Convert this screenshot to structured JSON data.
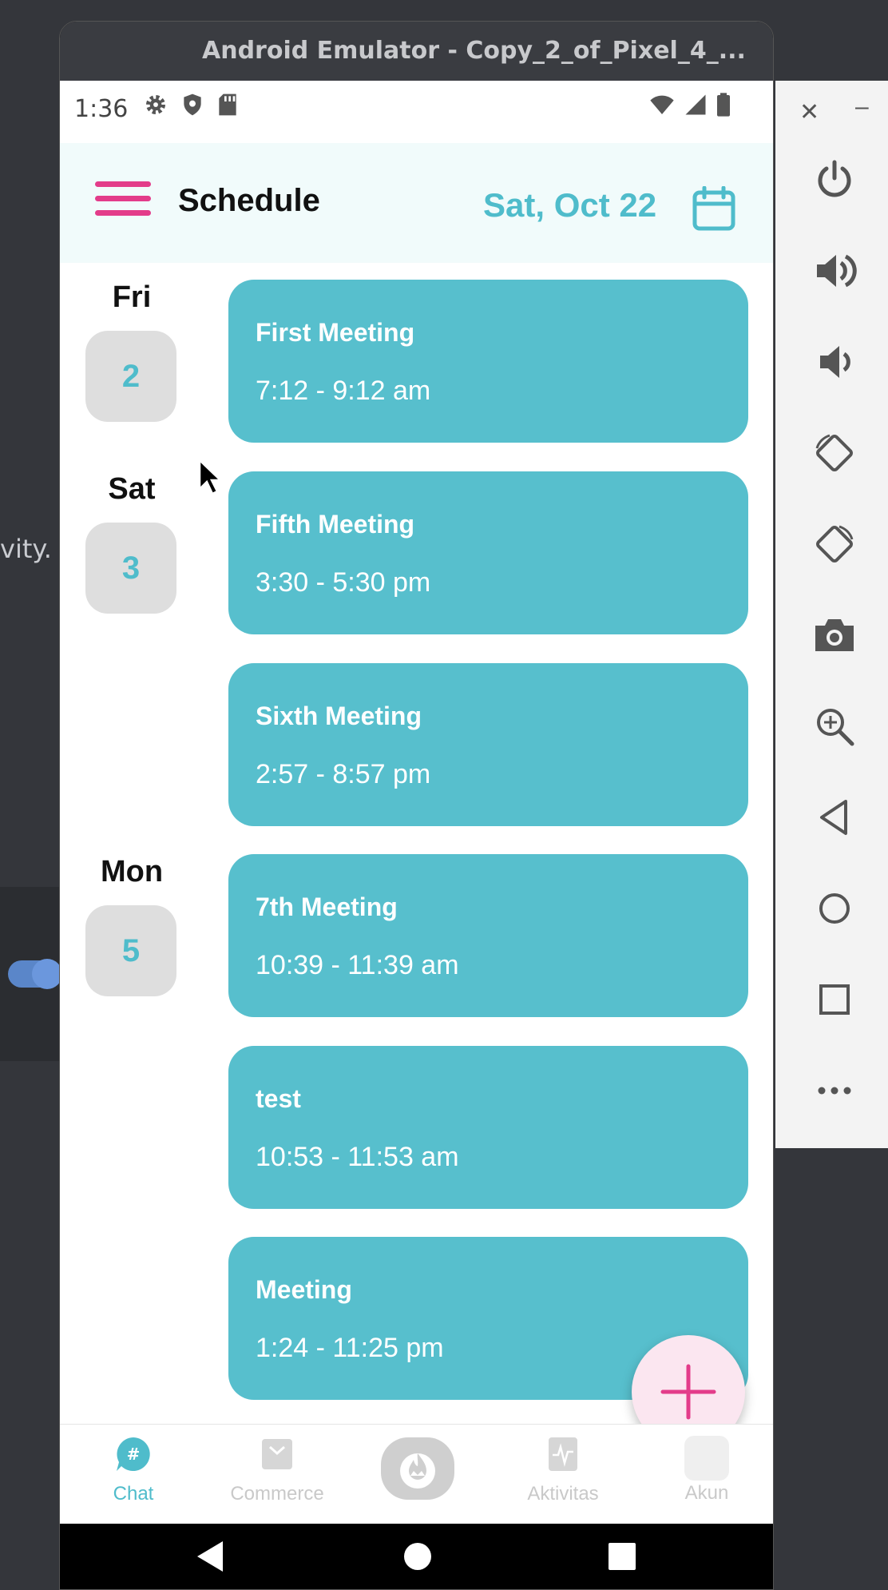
{
  "background": {
    "text": "vity."
  },
  "emulator": {
    "title": "Android Emulator - Copy_2_of_Pixel_4_..."
  },
  "statusbar": {
    "time": "1:36"
  },
  "appbar": {
    "title": "Schedule",
    "date": "Sat, Oct 22"
  },
  "days": [
    {
      "name": "Fri",
      "number": "2"
    },
    {
      "name": "Sat",
      "number": "3"
    },
    {
      "name": "Mon",
      "number": "5"
    }
  ],
  "events": [
    {
      "title": "First Meeting",
      "time": "7:12 - 9:12 am"
    },
    {
      "title": "Fifth Meeting",
      "time": "3:30 - 5:30 pm"
    },
    {
      "title": "Sixth Meeting",
      "time": "2:57 - 8:57 pm"
    },
    {
      "title": "7th Meeting",
      "time": "10:39 - 11:39 am"
    },
    {
      "title": "test",
      "time": "10:53 - 11:53 am"
    },
    {
      "title": "Meeting",
      "time": "1:24 - 11:25 pm"
    }
  ],
  "bottomnav": {
    "items": [
      {
        "label": "Chat",
        "icon": "chat-icon",
        "active": true
      },
      {
        "label": "Commerce",
        "icon": "commerce-icon",
        "active": false
      },
      {
        "label": "",
        "icon": "fire-icon",
        "active": false
      },
      {
        "label": "Aktivitas",
        "icon": "activity-icon",
        "active": false
      },
      {
        "label": "Akun",
        "icon": "account-icon",
        "active": false
      }
    ]
  },
  "colors": {
    "accent": "#4fbccb",
    "card": "#57bfcd",
    "pink": "#e33c8a",
    "appbar_bg": "#f1fbfb"
  },
  "toolbar": {
    "buttons": [
      "power-icon",
      "volume-up-icon",
      "volume-down-icon",
      "rotate-left-icon",
      "rotate-right-icon",
      "camera-icon",
      "zoom-icon",
      "back-icon",
      "home-icon",
      "overview-icon",
      "more-icon"
    ]
  }
}
